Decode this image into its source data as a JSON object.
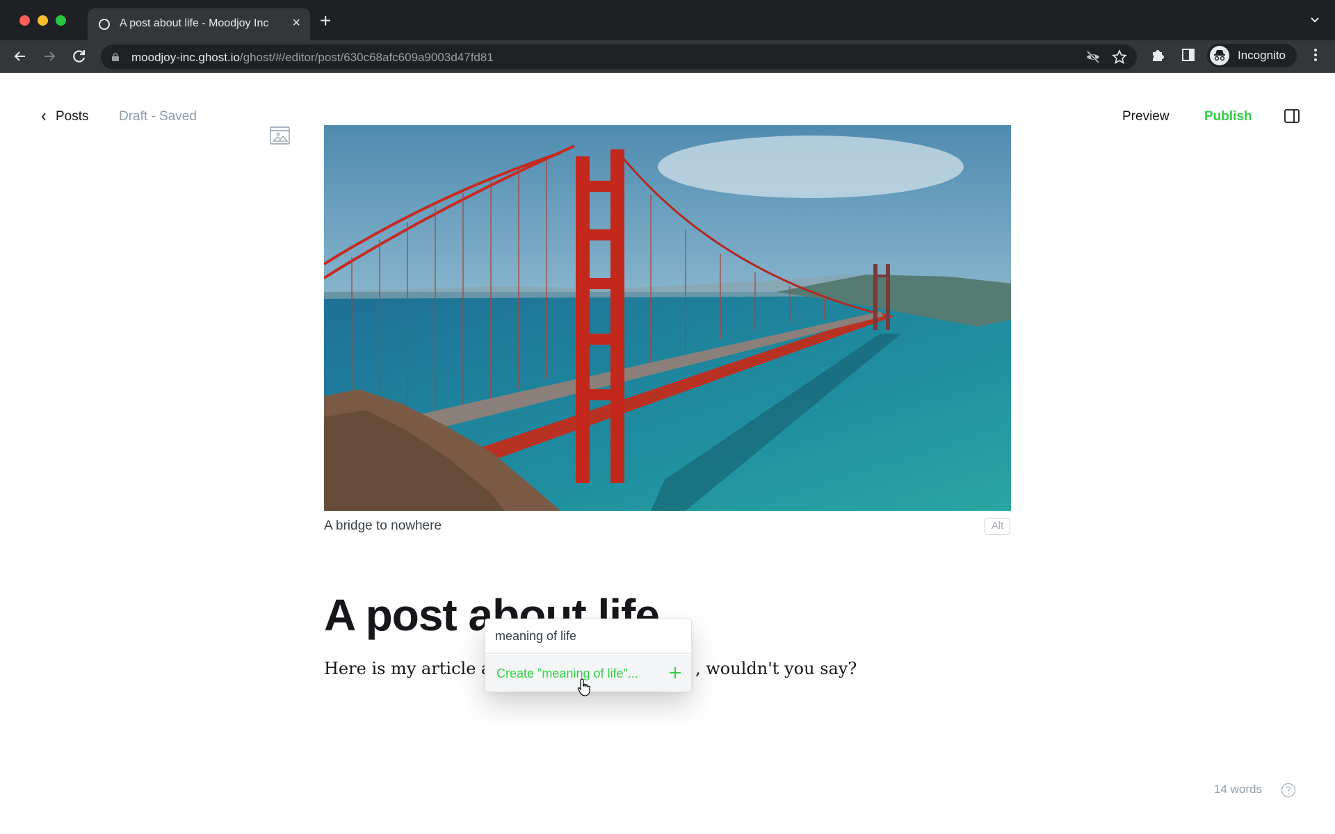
{
  "browser": {
    "tab": {
      "title": "A post about life - Moodjoy Inc",
      "close_label": "×"
    },
    "new_tab_label": "+",
    "url": {
      "host": "moodjoy-inc.ghost.io",
      "path": "/ghost/#/editor/post/630c68afc609a9003d47fd81"
    },
    "profile_label": "Incognito",
    "icons": [
      "back-arrow-icon",
      "forward-arrow-icon",
      "reload-icon",
      "lock-icon",
      "eye-off-icon",
      "star-icon",
      "puzzle-icon",
      "side-panel-icon",
      "incognito-icon",
      "more-vert-icon",
      "chevron-down-icon"
    ]
  },
  "editor": {
    "header": {
      "back_label": "Posts",
      "status": "Draft - Saved",
      "preview_label": "Preview",
      "publish_label": "Publish"
    },
    "feature_image": {
      "caption": "A bridge to nowhere",
      "alt_label": "Alt"
    },
    "title": "A post about life",
    "body_start": "Here is my article a",
    "body_end": ", wouldn't you say?",
    "word_count": "14 words"
  },
  "popup": {
    "input_value": "meaning of life",
    "create_option": "Create \"meaning of life\"..."
  },
  "colors": {
    "accent_green": "#30cf43",
    "text_dark": "#15171a",
    "muted": "#8e9cac"
  }
}
